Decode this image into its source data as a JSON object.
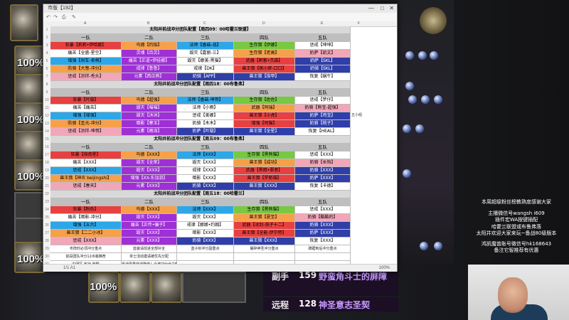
{
  "window": {
    "title": "市版【192】",
    "status_left": "1/1 A1",
    "zoom": "100%",
    "columns": [
      "A",
      "B",
      "C",
      "D",
      "E",
      "F"
    ]
  },
  "sections": [
    {
      "title": "太阳井前战冲分团队配置【周四09：00哈霍兰联盟】",
      "headers": [
        "一队",
        "二队",
        "三队",
        "四队",
        "五队"
      ],
      "rows": [
        [
          "狂暴【莉莉•伊哈娜】",
          "鸟德【灼焰】",
          "法师【香菇-战】",
          "生存猎【伊娜】",
          "惩戒【坤坤】"
        ],
        [
          "痛苦【全盛-星空】",
          "灵魂【百灵】",
          "毁灭【嘉丽-三】",
          "生存猎【老高】",
          "奶萨【凯文】"
        ],
        [
          "增强【刹车-卖萌】",
          "痛苦【正道•伊娃娜】",
          "毁灭【娜美-黑猫】",
          "武器【刺客•杰森】",
          "奶萨【SKL】"
        ],
        [
          "防骑【大葱-冲分】",
          "戒律【鲁鲁】",
          "戒律【DK】",
          "兽王猎【桃小胖-口口】",
          "奶骑【SKL】"
        ],
        [
          "惩戒【凉拌-秃头】",
          "元素【西瓜熊】",
          "奶骑【APP】",
          "兽王猎【指甲】",
          "恢复【蜗牛】"
        ]
      ]
    },
    {
      "title": "太阳井前战冲分团队配置【周四18：00布鲁弗】",
      "headers": [
        "一队",
        "二队",
        "三队",
        "四队",
        "五队"
      ],
      "rows": [
        [
          "狂暴【叶璇】",
          "鸟德【超强】",
          "法师【香菇-坤哥】",
          "生存猎【佐佐】",
          "惩戒【梦仔】"
        ],
        [
          "痛苦【痛苦】",
          "毁灭【喵喵】",
          "法师【小雨】",
          "武器【阿瑞】",
          "奶骑【熊宝-超强】"
        ],
        [
          "增强【增强】",
          "毁灭【沐沐】",
          "惩戒【美娜】",
          "兽王猎【小虎】",
          "奶萨【鸡宝】"
        ],
        [
          "防骑【圣光-冲分】",
          "暗影【寒玉】",
          "奶骑【木木】",
          "增强【阿猫】",
          "奶骑【桃子】"
        ],
        [
          "惩戒【凉拌-坤哥】",
          "元素【雨泽】",
          "奶萨【叶璇】",
          "兽王猎【全星】",
          "恢复【HEAL】"
        ]
      ]
    },
    {
      "title": "太阳井前战冲分团队配置【周五09：00布鲁弗】",
      "headers": [
        "一队",
        "二队",
        "三队",
        "四队",
        "五队"
      ],
      "rows": [
        [
          "狂暴【指南星】",
          "鸟德【XXX】",
          "法师【XXX】",
          "生存猎【黑熊猫】",
          "惩戒【XXX】"
        ],
        [
          "痛苦【XXX】",
          "毁灭【全荣】",
          "毁灭【XXX】",
          "兽王猎【成功】",
          "奶骑【长钩】"
        ],
        [
          "惩戒【XXX】",
          "毁灭【XXX】",
          "戒律【XXX】",
          "武器【黑暗•罪者】",
          "奶骑【XXX】"
        ],
        [
          "兽王猎【神炎 beijingshi】",
          "增强【XX-东加游】",
          "暗影【XXX】",
          "兽王猎【罗斯福】",
          "奶萨【XXX】"
        ],
        [
          "惩戒【春天】",
          "元素【XXX】",
          "奶骑【XXX】",
          "兽王猎【XXX】",
          "恢复【卡德】"
        ]
      ]
    },
    {
      "title": "太阳井前战冲分团队配置【周五18：00哈霍兰】",
      "headers": [
        "一队",
        "二队",
        "三队",
        "四队",
        "五队"
      ],
      "rows": [
        [
          "狂暴【粉色】",
          "鸟德【XXX】",
          "法师【XXX】",
          "生存猎【黑熊猫】",
          "惩戒【XXX】"
        ],
        [
          "痛苦【暗影-冲分】",
          "毁灭【XXX】",
          "毁灭【XXX】",
          "兽王猎【夏至】",
          "奶骑【酷酷的】"
        ],
        [
          "增强【五台】",
          "痛苦【正传•骗子】",
          "戒律【娜娜•约翰】",
          "武器【冰封-孩子十二】",
          "奶骑【XXX】"
        ],
        [
          "兽王猎【二二小冰】",
          "毁灭【XXX】",
          "暗影【XXX】",
          "兽王猎【全能-伊尔特】",
          "奶萨【XXX】"
        ],
        [
          "惩戒【XXX】",
          "元素【XXX】",
          "奶骑【XXX】",
          "兽王猎【XXX】",
          "恢复【XXX】"
        ]
      ]
    }
  ],
  "notes": [
    [
      "布阵时必须冲分重点",
      "蓝装请前进全部补全",
      "蓝子织冲分副重点",
      "碾碎神圣冲分重点",
      "蹲踞到后冲分重点"
    ],
    [
      "前段团队冲分12/6装推荐",
      "单士活动邀请被优先分配",
      "",
      "",
      ""
    ],
    [
      "中团区-炼狱-脑瞩",
      "千速零量装速降低！会被冲分全力帮助",
      "",
      "",
      ""
    ],
    [
      "团队血量100%-95%",
      "千速装速开启到达上天全力帮助",
      "",
      "",
      ""
    ],
    [
      "坊组与推和推理减伤",
      "起手12A炼表示",
      "",
      "",
      ""
    ],
    [
      "冲分组与推到最后分配重要高功能",
      "需二解冻推施分发至三个萨满不推荐",
      "",
      "",
      ""
    ],
    [
      "团队血量100%-95%",
      "",
      "",
      "",
      ""
    ],
    [
      "冲分时间请推到团队结束",
      "",
      "",
      "",
      ""
    ],
    [
      "其实团推推到到采用2、2、3、3-2",
      "",
      "",
      "",
      ""
    ]
  ],
  "side_note": "五小组",
  "ad_lines": [
    "本周超级粉丝榜教熟度感谢大家",
    "主播微信号wangsh i609",
    "插件宏WA按键插配",
    "哈霍兰联盟或布鲁弗落",
    "太阳井欢迎大家来玩~备战80级版本",
    "鸿凯魔兽账号微信号hk168643",
    "备注它智推荐有优惠"
  ],
  "game_text": [
    {
      "label": "副手",
      "value": "159",
      "name": "野蛮角斗士的屏障"
    },
    {
      "label": "远程",
      "value": "128",
      "name": "神圣意志圣契"
    }
  ],
  "hp_labels": [
    "100%",
    "100%",
    "100%",
    "100%",
    "100%"
  ],
  "colors": {
    "red": "#e84040",
    "orange": "#f6a04a",
    "purple": "#9e30d6",
    "blue": "#2ea7e8",
    "green": "#78c842",
    "white": "#ffffff",
    "pink": "#f2a7b9",
    "navy": "#2f3ea8",
    "cyan": "#46c8e6",
    "gold": "#d6a84a"
  }
}
